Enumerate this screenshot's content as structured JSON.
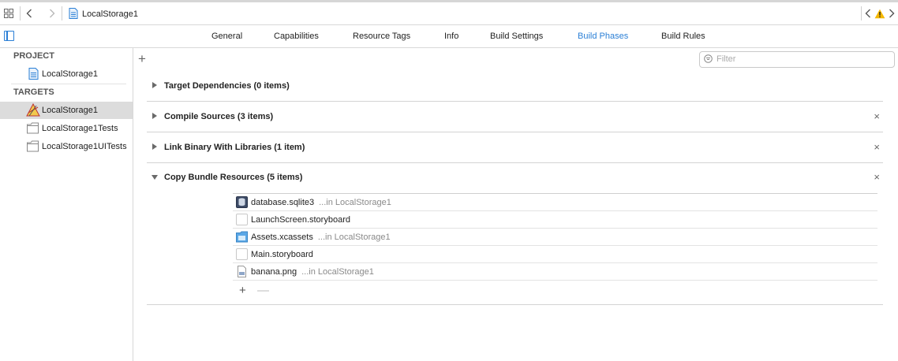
{
  "jumpbar": {
    "grid_icon": "related-items-icon",
    "back_icon": "chevron-left-icon",
    "forward_icon": "chevron-right-icon",
    "file_title": "LocalStorage1",
    "warning_icon": "warning-icon",
    "warning_color": "#f5b800"
  },
  "tabs": [
    {
      "label": "General"
    },
    {
      "label": "Capabilities"
    },
    {
      "label": "Resource Tags"
    },
    {
      "label": "Info"
    },
    {
      "label": "Build Settings"
    },
    {
      "label": "Build Phases",
      "active": true
    },
    {
      "label": "Build Rules"
    }
  ],
  "sidebar": {
    "project_header": "PROJECT",
    "project_item": "LocalStorage1",
    "targets_header": "TARGETS",
    "targets": [
      {
        "label": "LocalStorage1",
        "icon": "app-target-icon",
        "selected": true
      },
      {
        "label": "LocalStorage1Tests",
        "icon": "test-bundle-icon"
      },
      {
        "label": "LocalStorage1UITests",
        "icon": "test-bundle-icon"
      }
    ]
  },
  "main": {
    "add_label": "+",
    "filter_placeholder": "Filter",
    "phases": [
      {
        "title": "Target Dependencies (0 items)",
        "expanded": false,
        "removable": false
      },
      {
        "title": "Compile Sources (3 items)",
        "expanded": false,
        "removable": true
      },
      {
        "title": "Link Binary With Libraries (1 item)",
        "expanded": false,
        "removable": true
      },
      {
        "title": "Copy Bundle Resources (5 items)",
        "expanded": true,
        "removable": true
      }
    ],
    "remove_label": "×",
    "resources": [
      {
        "name": "database.sqlite3",
        "location": "...in LocalStorage1",
        "icon": "database-file-icon"
      },
      {
        "name": "LaunchScreen.storyboard",
        "location": "",
        "icon": "storyboard-file-icon"
      },
      {
        "name": "Assets.xcassets",
        "location": "...in LocalStorage1",
        "icon": "asset-catalog-icon"
      },
      {
        "name": "Main.storyboard",
        "location": "",
        "icon": "storyboard-file-icon"
      },
      {
        "name": "banana.png",
        "location": "...in LocalStorage1",
        "icon": "image-file-icon"
      }
    ],
    "row_add_label": "+",
    "row_remove_label": "—"
  },
  "colors": {
    "accent": "#2a7fd6",
    "selection": "#dcdcdc"
  }
}
